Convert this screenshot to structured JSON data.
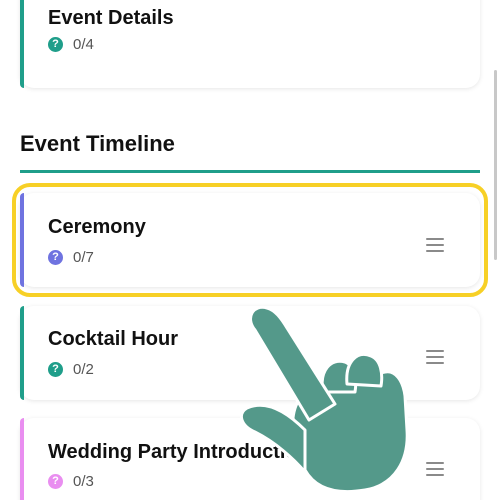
{
  "event_details": {
    "title": "Event Details",
    "progress": "0/4",
    "accent_color": "#1f9e8a"
  },
  "timeline": {
    "heading": "Event Timeline",
    "items": [
      {
        "title": "Ceremony",
        "progress": "0/7",
        "accent_color": "#6f73e0",
        "highlighted": true
      },
      {
        "title": "Cocktail Hour",
        "progress": "0/2",
        "accent_color": "#1f9e8a",
        "highlighted": false
      },
      {
        "title": "Wedding Party Introductions",
        "progress": "0/3",
        "accent_color": "#e98ef0",
        "highlighted": false
      }
    ]
  },
  "icons": {
    "progress_icon": "question-circle-icon",
    "drag_icon": "drag-handle-icon",
    "pointer": "pointing-hand-icon"
  },
  "colors": {
    "highlight": "#f7d026",
    "hand": "#54998a"
  }
}
